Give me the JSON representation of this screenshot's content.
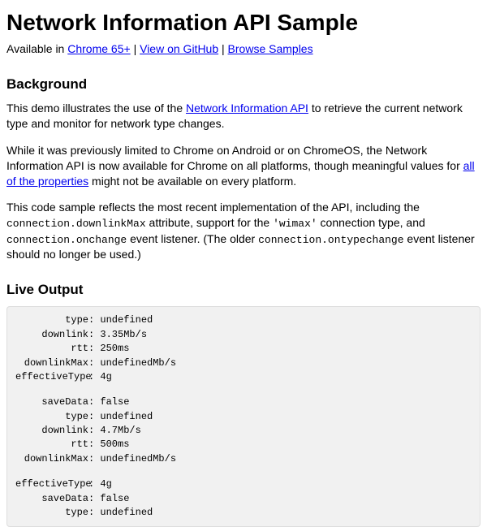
{
  "title": "Network Information API Sample",
  "availability": {
    "prefix": "Available in ",
    "chrome": "Chrome 65+",
    "sep1": " | ",
    "github": "View on GitHub",
    "sep2": " | ",
    "samples": "Browse Samples"
  },
  "background": {
    "heading": "Background",
    "p1_a": "This demo illustrates the use of the ",
    "p1_link": "Network Information API",
    "p1_b": " to retrieve the current network type and monitor for network type changes.",
    "p2_a": "While it was previously limited to Chrome on Android or on ChromeOS, the Network Information API is now available for Chrome on all platforms, though meaningful values for ",
    "p2_link": "all of the properties",
    "p2_b": " might not be available on every platform.",
    "p3_a": "This code sample reflects the most recent implementation of the API, including the ",
    "p3_code1": "connection.downlinkMax",
    "p3_b": " attribute, support for the ",
    "p3_code2": "'wimax'",
    "p3_c": " connection type, and ",
    "p3_code3": "connection.onchange",
    "p3_d": " event listener. (The older ",
    "p3_code4": "connection.ontypechange",
    "p3_e": " event listener should no longer be used.)"
  },
  "live": {
    "heading": "Live Output",
    "rows": [
      {
        "label": "type",
        "value": "undefined"
      },
      {
        "label": "downlink",
        "value": "3.35Mb/s"
      },
      {
        "label": "rtt",
        "value": "250ms"
      },
      {
        "label": "downlinkMax",
        "value": "undefinedMb/s"
      },
      {
        "label": "effectiveType",
        "value": "4g"
      },
      {
        "blank": true
      },
      {
        "label": "saveData",
        "value": "false"
      },
      {
        "label": "type",
        "value": "undefined"
      },
      {
        "label": "downlink",
        "value": "4.7Mb/s"
      },
      {
        "label": "rtt",
        "value": "500ms"
      },
      {
        "label": "downlinkMax",
        "value": "undefinedMb/s"
      },
      {
        "blank": true
      },
      {
        "label": "effectiveType",
        "value": "4g"
      },
      {
        "label": "saveData",
        "value": "false"
      },
      {
        "label": "type",
        "value": "undefined"
      }
    ]
  }
}
